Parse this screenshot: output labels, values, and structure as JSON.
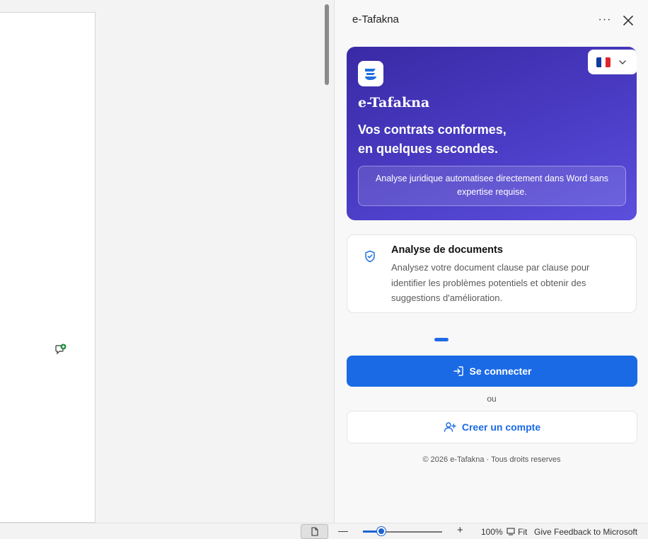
{
  "pane": {
    "title": "e-Tafakna",
    "more_label": "···"
  },
  "hero": {
    "language": "FR",
    "flag_colors": [
      "#0f3aa0",
      "#ffffff",
      "#e1242c"
    ],
    "brand": "e-Tafakna",
    "headline_line1": "Vos contrats conformes,",
    "headline_line2": "en quelques secondes.",
    "note": "Analyse juridique automatisee directement dans Word sans expertise requise."
  },
  "feature": {
    "title": "Analyse de documents",
    "description": "Analysez votre document clause par clause pour identifier les problèmes potentiels et obtenir des suggestions d'amélioration."
  },
  "actions": {
    "login_label": "Se connecter",
    "or_label": "ou",
    "signup_label": "Creer un compte"
  },
  "footer": {
    "copyright": "© 2026 e-Tafakna · Tous droits reserves"
  },
  "status_bar": {
    "zoom_out": "—",
    "zoom_in": "+",
    "zoom_level": "100%",
    "zoom_fraction": 0.23,
    "fit_label": "Fit",
    "feedback": "Give Feedback to Microsoft"
  },
  "colors": {
    "accent": "#1a6ae6",
    "hero_gradient_start": "#3a2aa6",
    "hero_gradient_end": "#5b4fdd"
  }
}
